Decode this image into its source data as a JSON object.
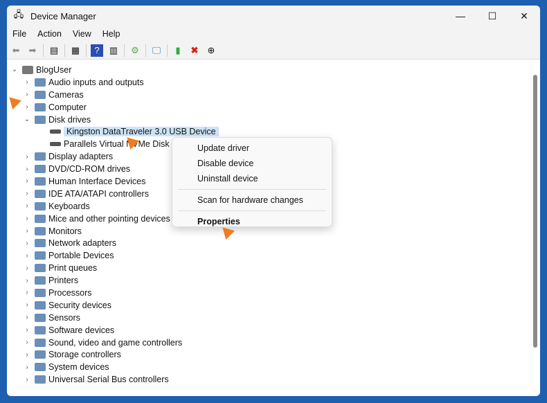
{
  "window": {
    "title": "Device Manager",
    "minimize": "—",
    "maximize": "☐",
    "close": "✕"
  },
  "menu": [
    "File",
    "Action",
    "View",
    "Help"
  ],
  "tree": {
    "root": "BlogUser",
    "items": [
      {
        "label": "Audio inputs and outputs",
        "expanded": false
      },
      {
        "label": "Cameras",
        "expanded": false
      },
      {
        "label": "Computer",
        "expanded": false
      },
      {
        "label": "Disk drives",
        "expanded": true,
        "children": [
          "Kingston DataTraveler 3.0 USB Device",
          "Parallels Virtual NVMe Disk"
        ]
      },
      {
        "label": "Display adapters"
      },
      {
        "label": "DVD/CD-ROM drives"
      },
      {
        "label": "Human Interface Devices"
      },
      {
        "label": "IDE ATA/ATAPI controllers"
      },
      {
        "label": "Keyboards"
      },
      {
        "label": "Mice and other pointing devices"
      },
      {
        "label": "Monitors"
      },
      {
        "label": "Network adapters"
      },
      {
        "label": "Portable Devices"
      },
      {
        "label": "Print queues"
      },
      {
        "label": "Printers"
      },
      {
        "label": "Processors"
      },
      {
        "label": "Security devices"
      },
      {
        "label": "Sensors"
      },
      {
        "label": "Software devices"
      },
      {
        "label": "Sound, video and game controllers"
      },
      {
        "label": "Storage controllers"
      },
      {
        "label": "System devices"
      },
      {
        "label": "Universal Serial Bus controllers"
      }
    ]
  },
  "context_menu": {
    "update": "Update driver",
    "disable": "Disable device",
    "uninstall": "Uninstall device",
    "scan": "Scan for hardware changes",
    "properties": "Properties"
  }
}
